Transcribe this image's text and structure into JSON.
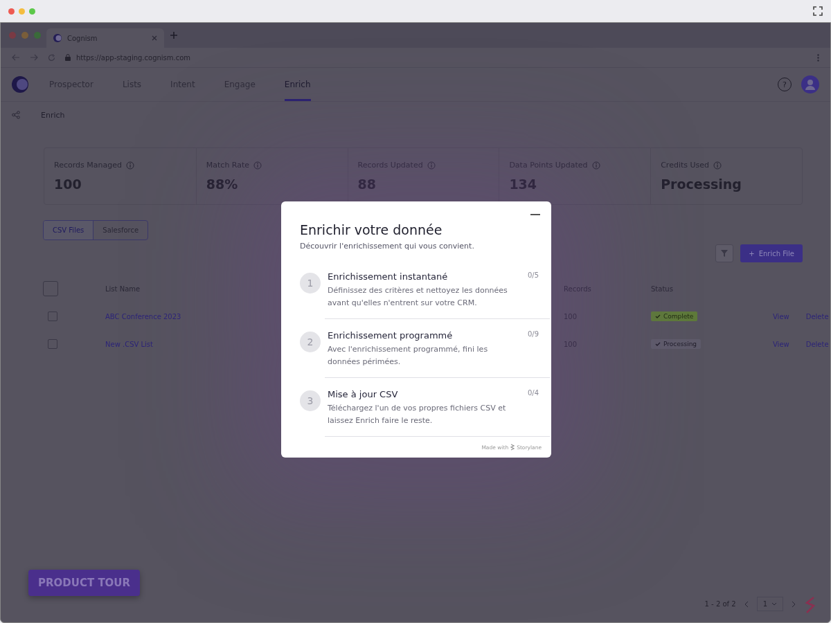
{
  "browser": {
    "tab_title": "Cognism",
    "url": "https://app-staging.cognism.com"
  },
  "nav": {
    "tabs": [
      {
        "label": "Prospector",
        "selected": false
      },
      {
        "label": "Lists",
        "selected": false
      },
      {
        "label": "Intent",
        "selected": false
      },
      {
        "label": "Engage",
        "selected": false
      },
      {
        "label": "Enrich",
        "selected": true
      }
    ],
    "help": "?"
  },
  "breadcrumb": "Enrich",
  "stats": [
    {
      "label": "Records Managed",
      "value": "100"
    },
    {
      "label": "Match Rate",
      "value": "88%"
    },
    {
      "label": "Records Updated",
      "value": "88"
    },
    {
      "label": "Data Points Updated",
      "value": "134"
    },
    {
      "label": "Credits Used",
      "value": "Processing"
    }
  ],
  "source_tabs": [
    {
      "label": "CSV Files",
      "selected": true
    },
    {
      "label": "Salesforce",
      "selected": false
    }
  ],
  "enrich_button": {
    "icon": "+",
    "label": "Enrich File"
  },
  "table": {
    "select_all": {
      "checked": false
    },
    "columns": [
      "List Name",
      "Records",
      "Status"
    ],
    "rows": [
      {
        "checked": false,
        "name": "ABC Conference 2023",
        "records": "100",
        "status": "Complete",
        "kind": "complete",
        "actions": [
          "View",
          "Delete"
        ]
      },
      {
        "checked": false,
        "name": "New .CSV List",
        "records": "100",
        "status": "Processing",
        "kind": "processing",
        "actions": [
          "View",
          "Delete"
        ]
      }
    ]
  },
  "pagination": {
    "range": "1 - 2 of 2",
    "page": "1"
  },
  "product_tour": "PRODUCT TOUR",
  "modal": {
    "title": "Enrichir votre donnée",
    "subtitle": "Découvrir l'enrichissement qui vous convient.",
    "steps": [
      {
        "number": "1",
        "title": "Enrichissement instantané",
        "description": "Définissez des critères et nettoyez les données avant qu'elles n'entrent sur votre CRM.",
        "progress": "0/5",
        "completed": false
      },
      {
        "number": "2",
        "title": "Enrichissement programmé",
        "description": "Avec l'enrichissement programmé, fini les données périmées.",
        "progress": "0/9",
        "completed": false
      },
      {
        "number": "3",
        "title": "Mise à jour CSV",
        "description": "Téléchargez l'un de vos propres fichiers CSV et laissez Enrich faire le reste.",
        "progress": "0/4",
        "completed": false
      }
    ],
    "footer": "Made with",
    "brand": "Storylane"
  }
}
